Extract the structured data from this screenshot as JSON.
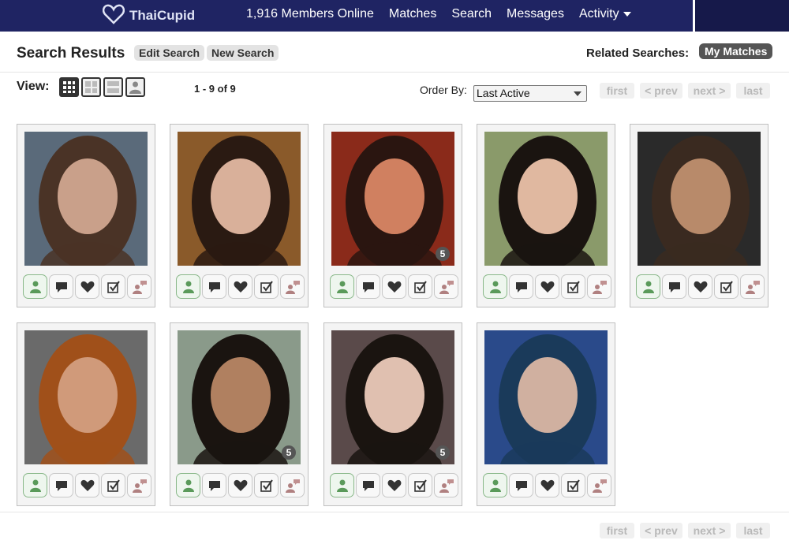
{
  "nav": {
    "logo_text": "ThaiCupid",
    "members_online": "1,916 Members Online",
    "matches": "Matches",
    "search": "Search",
    "messages": "Messages",
    "activity": "Activity"
  },
  "header": {
    "title": "Search Results",
    "edit_search": "Edit Search",
    "new_search": "New Search",
    "related_label": "Related Searches:",
    "my_matches": "My Matches"
  },
  "view": {
    "label": "View:",
    "count": "1 - 9 of 9",
    "order_by_label": "Order By:",
    "order_by_value": "Last Active"
  },
  "pagination": {
    "first": "first",
    "prev": "< prev",
    "next": "next >",
    "last": "last"
  },
  "profiles": [
    {
      "photo_count": ""
    },
    {
      "photo_count": ""
    },
    {
      "photo_count": "5"
    },
    {
      "photo_count": ""
    },
    {
      "photo_count": ""
    },
    {
      "photo_count": ""
    },
    {
      "photo_count": "5"
    },
    {
      "photo_count": "5"
    },
    {
      "photo_count": ""
    }
  ],
  "colors": {
    "nav_bg": "#1f2463",
    "pager_text": "#b8b8b8",
    "profile_icon_green": "#5a9a5a"
  }
}
